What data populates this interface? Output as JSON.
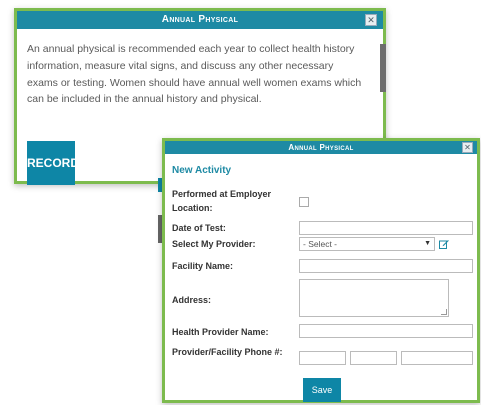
{
  "back_dialog": {
    "title": "Annual Physical",
    "close_glyph": "✕",
    "description": "An annual physical is recommended each year to collect health history information, measure vital signs, and discuss any other necessary exams or testing. Women should have annual well women exams which can be included in the annual history and physical.",
    "record_label": "RECORD"
  },
  "front_dialog": {
    "title": "Annual Physical",
    "close_glyph": "✕",
    "subheading": "New Activity",
    "fields": {
      "performed_at_employer_label": "Performed at Employer Location:",
      "date_of_test_label": "Date of Test:",
      "date_of_test_value": "",
      "select_provider_label": "Select My Provider:",
      "select_provider_value": "- Select -",
      "facility_name_label": "Facility Name:",
      "facility_name_value": "",
      "address_label": "Address:",
      "address_value": "",
      "health_provider_name_label": "Health Provider Name:",
      "health_provider_name_value": "",
      "phone_label": "Provider/Facility Phone #:",
      "phone_area_value": "",
      "phone_prefix_value": "",
      "phone_line_value": ""
    },
    "save_label": "Save"
  },
  "colors": {
    "titlebar": "#1e8aa4",
    "border_green": "#7dbb4e",
    "button_teal": "#0e86a6"
  },
  "icons": {
    "close": "close-icon",
    "edit": "edit-icon",
    "dropdown": "chevron-down-icon"
  }
}
